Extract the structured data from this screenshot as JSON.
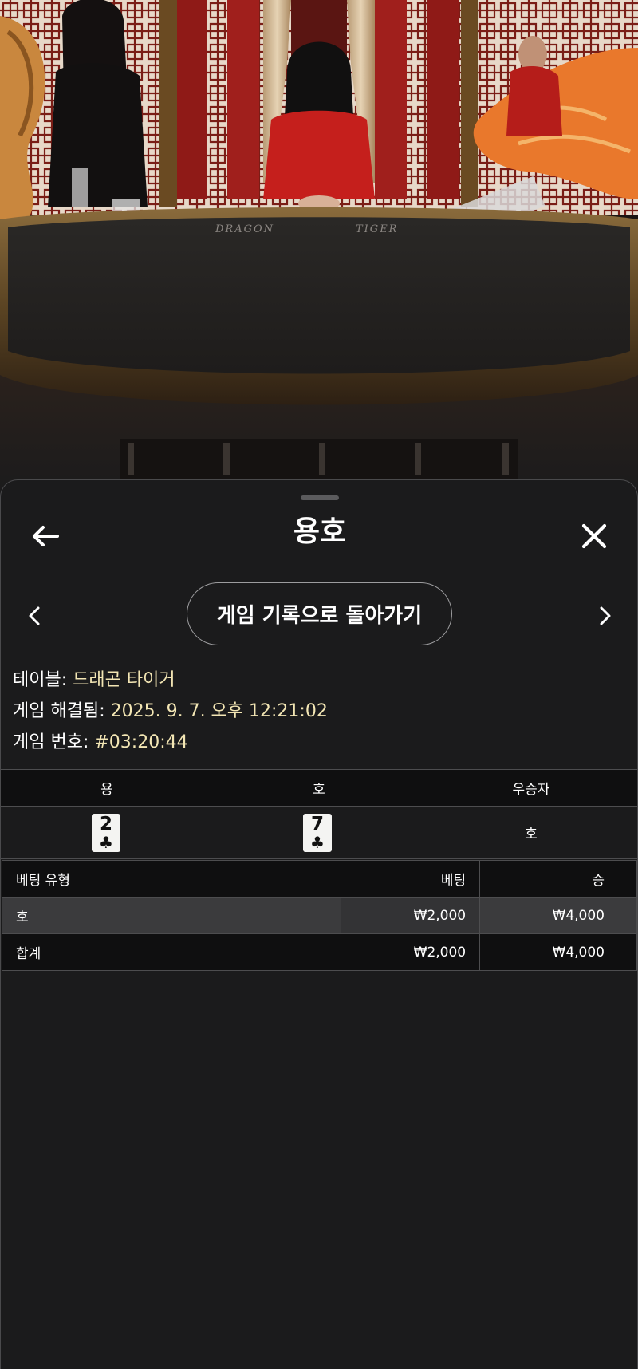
{
  "stream": {
    "felt_labels": {
      "dragon": "DRAGON",
      "tiger": "TIGER"
    }
  },
  "sheet": {
    "title": "용호",
    "back_icon": "arrow-left-icon",
    "close_icon": "close-x-icon",
    "prev_icon": "chevron-left-icon",
    "next_icon": "chevron-right-icon",
    "history_button_label": "게임 기록으로 돌아가기"
  },
  "info": {
    "table_label": "테이블:",
    "table_value": "드래곤 타이거",
    "resolved_label": "게임 해결됨:",
    "resolved_value": "2025. 9. 7. 오후 12:21:02",
    "game_no_label": "게임 번호:",
    "game_no_value": "#03:20:44"
  },
  "result": {
    "headers": [
      "용",
      "호",
      "우승자"
    ],
    "dragon_card": {
      "rank": "2",
      "suit": "♣"
    },
    "tiger_card": {
      "rank": "7",
      "suit": "♣"
    },
    "winner": "호"
  },
  "bets": {
    "headers": [
      "베팅 유형",
      "베팅",
      "승"
    ],
    "rows": [
      {
        "type": "호",
        "bet": "₩2,000",
        "win": "₩4,000"
      },
      {
        "type": "합계",
        "bet": "₩2,000",
        "win": "₩4,000"
      }
    ]
  },
  "colors": {
    "sheet_bg": "#1b1b1c",
    "info_value": "#f3e6b4",
    "highlight_row": "#3b3b3d"
  }
}
